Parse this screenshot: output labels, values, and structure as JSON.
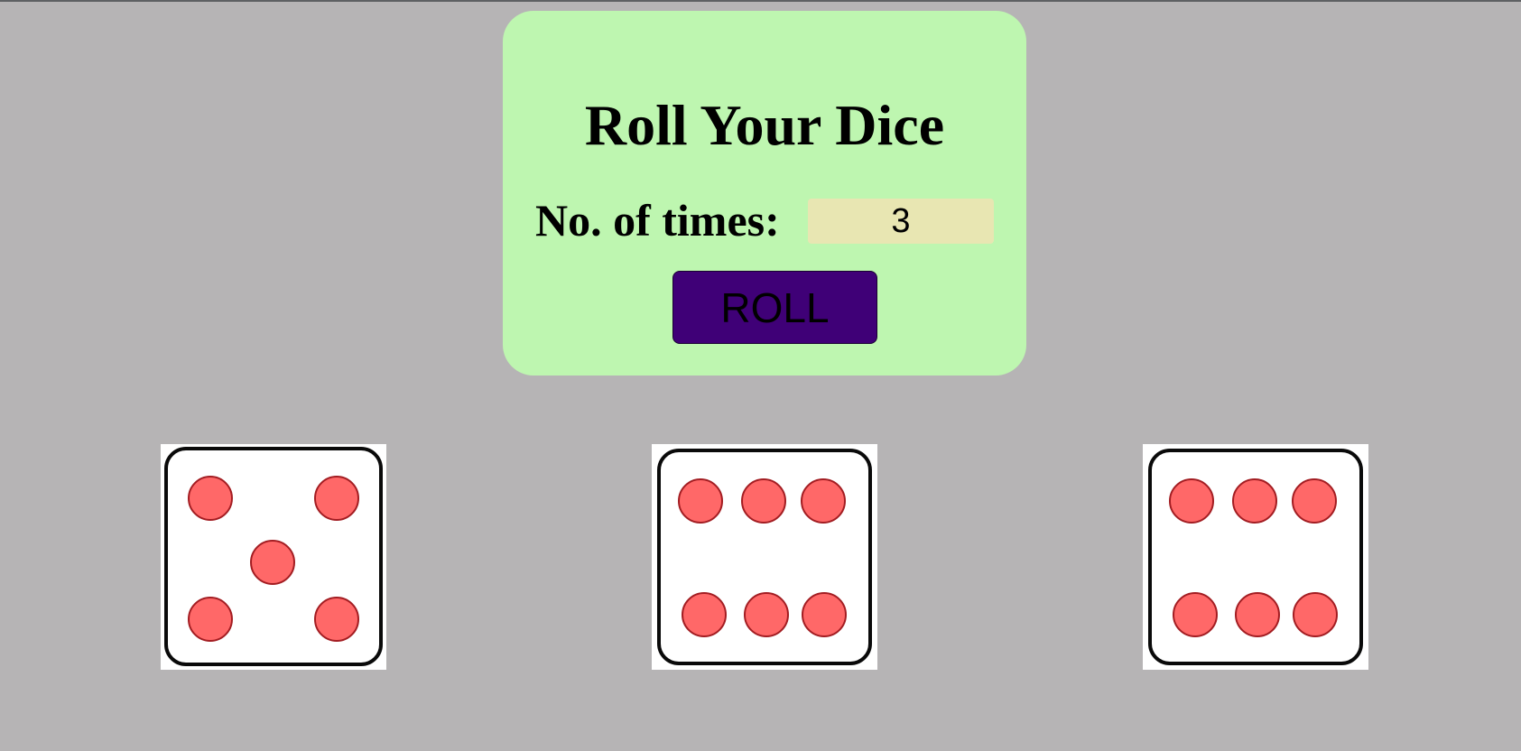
{
  "roller": {
    "title": "Roll Your Dice",
    "times_label": "No. of times:",
    "times_value": "3",
    "roll_label": "ROLL"
  },
  "dice": [
    {
      "value": 5,
      "icon": "dice-five-icon"
    },
    {
      "value": 6,
      "icon": "dice-six-icon"
    },
    {
      "value": 6,
      "icon": "dice-six-icon"
    }
  ],
  "colors": {
    "background": "#b6b4b5",
    "panel": "#bef6b0",
    "input": "#e8e6b2",
    "roll_button": "#3f0077",
    "pip": "#ff6868",
    "pip_outline": "#a31d22"
  }
}
